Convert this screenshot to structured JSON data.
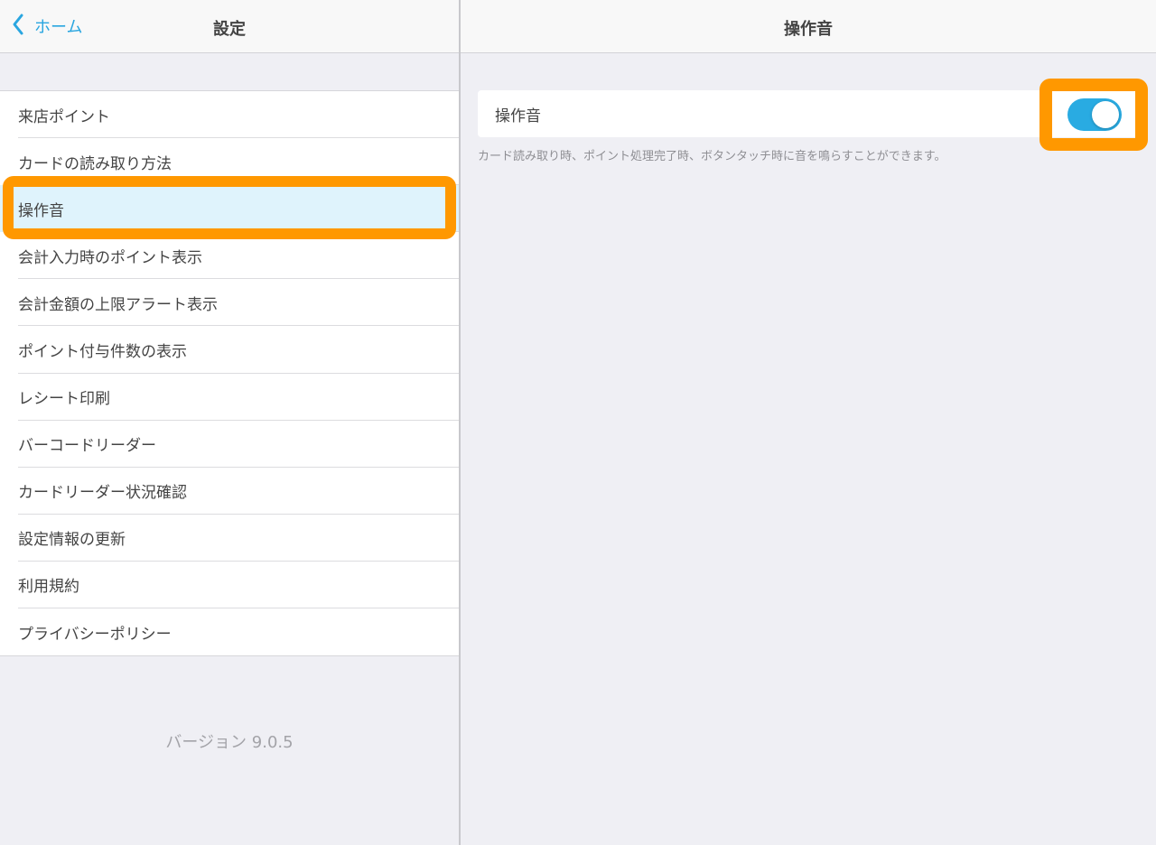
{
  "left_nav": {
    "back_label": "ホーム",
    "title": "設定"
  },
  "menu": {
    "items": [
      {
        "label": "来店ポイント",
        "selected": false
      },
      {
        "label": "カードの読み取り方法",
        "selected": false
      },
      {
        "label": "操作音",
        "selected": true
      },
      {
        "label": "会計入力時のポイント表示",
        "selected": false
      },
      {
        "label": "会計金額の上限アラート表示",
        "selected": false
      },
      {
        "label": "ポイント付与件数の表示",
        "selected": false
      },
      {
        "label": "レシート印刷",
        "selected": false
      },
      {
        "label": "バーコードリーダー",
        "selected": false
      },
      {
        "label": "カードリーダー状況確認",
        "selected": false
      },
      {
        "label": "設定情報の更新",
        "selected": false
      },
      {
        "label": "利用規約",
        "selected": false
      },
      {
        "label": "プライバシーポリシー",
        "selected": false
      }
    ]
  },
  "version": "バージョン 9.0.5",
  "right_nav": {
    "title": "操作音"
  },
  "setting": {
    "label": "操作音",
    "toggle_on": true,
    "help_text": "カード読み取り時、ポイント処理完了時、ボタンタッチ時に音を鳴らすことができます。"
  },
  "colors": {
    "accent": "#2aa6e0",
    "highlight": "#ff9800",
    "selected_bg": "#dff3fc",
    "toggle_on": "#29abe2"
  }
}
